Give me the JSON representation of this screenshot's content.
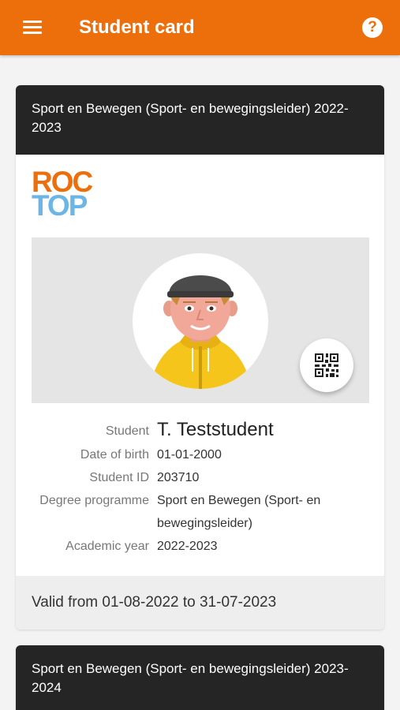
{
  "appbar": {
    "title": "Student card",
    "menu_icon": "hamburger-menu-icon",
    "help_icon": "question-mark-icon",
    "help_glyph": "?"
  },
  "colors": {
    "brand_orange": "#ec6f0c",
    "logo_blue": "#6cb6e6",
    "header_dark": "#252525"
  },
  "cards": [
    {
      "header": "Sport en Bewegen (Sport- en bewegingsleider) 2022-2023",
      "logo": {
        "line1": "ROC",
        "line2": "TOP"
      },
      "fields": {
        "student_label": "Student",
        "student_value": "T. Teststudent",
        "dob_label": "Date of birth",
        "dob_value": "01-01-2000",
        "id_label": "Student ID",
        "id_value": "203710",
        "degree_label": "Degree programme",
        "degree_value": "Sport en Bewegen (Sport- en bewegingsleider)",
        "year_label": "Academic year",
        "year_value": "2022-2023"
      },
      "valid": "Valid from 01-08-2022 to 31-07-2023"
    },
    {
      "header": "Sport en Bewegen (Sport- en bewegingsleider) 2023-2024"
    }
  ]
}
